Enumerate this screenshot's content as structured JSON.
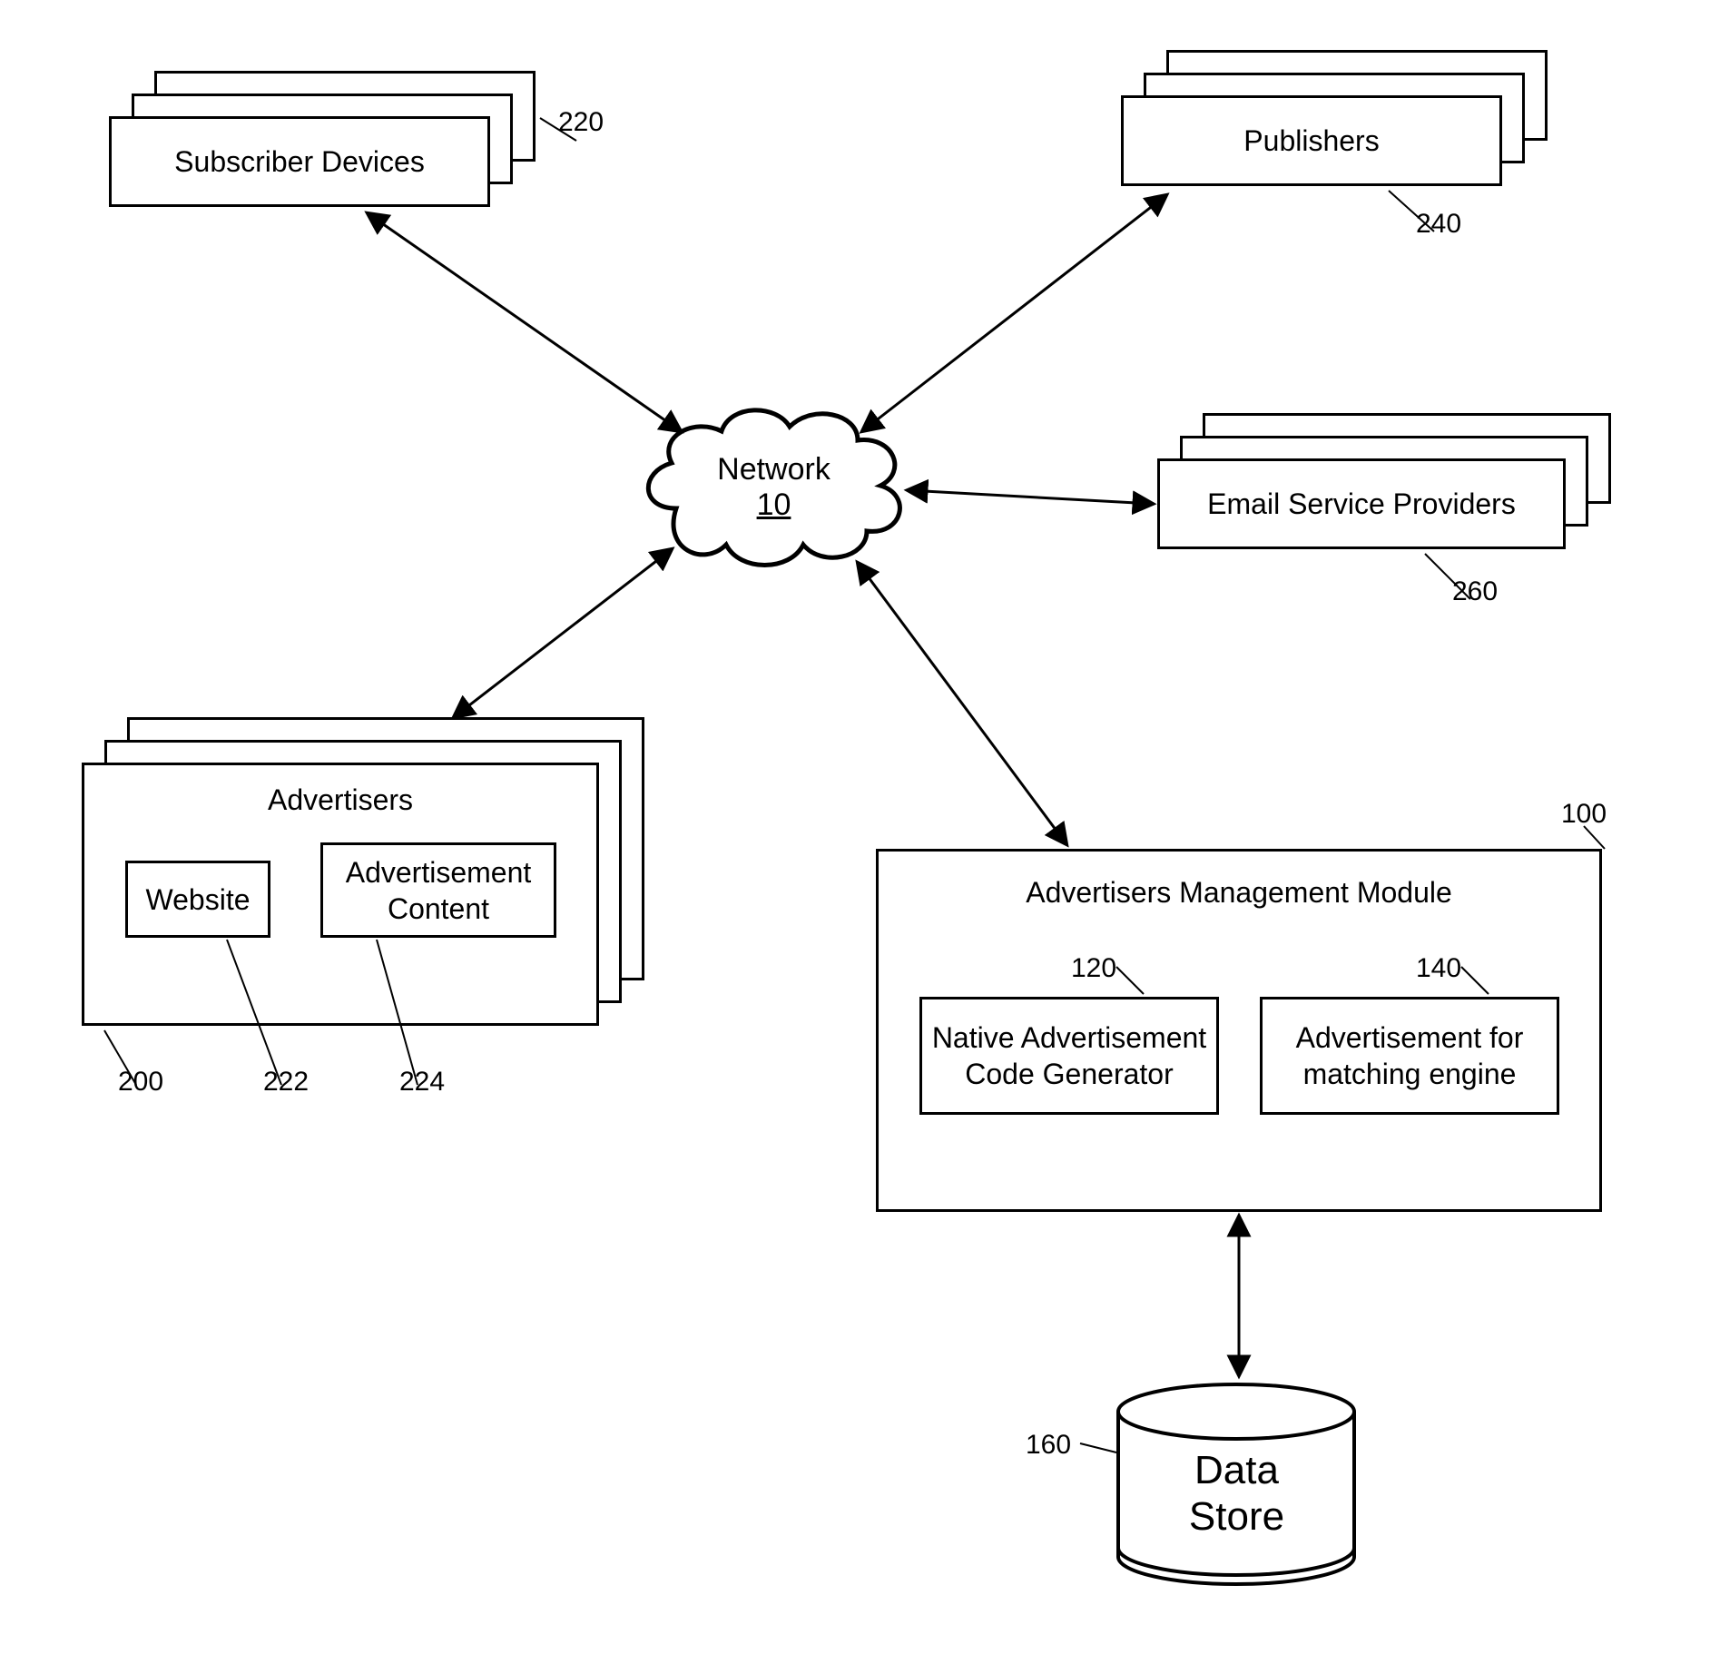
{
  "nodes": {
    "subscriber_devices": {
      "label": "Subscriber Devices",
      "ref": "220"
    },
    "publishers": {
      "label": "Publishers",
      "ref": "240"
    },
    "email_providers": {
      "label": "Email Service Providers",
      "ref": "260"
    },
    "network": {
      "label": "Network",
      "num": "10"
    },
    "advertisers": {
      "label": "Advertisers",
      "ref": "200",
      "website": {
        "label": "Website",
        "ref": "222"
      },
      "ad_content": {
        "label": "Advertisement Content",
        "ref": "224"
      }
    },
    "amm": {
      "label": "Advertisers Management Module",
      "ref": "100",
      "native_gen": {
        "label": "Native Advertisement Code Generator",
        "ref": "120"
      },
      "match_engine": {
        "label": "Advertisement for matching engine",
        "ref": "140"
      }
    },
    "data_store": {
      "label": "Data Store",
      "ref": "160"
    }
  }
}
